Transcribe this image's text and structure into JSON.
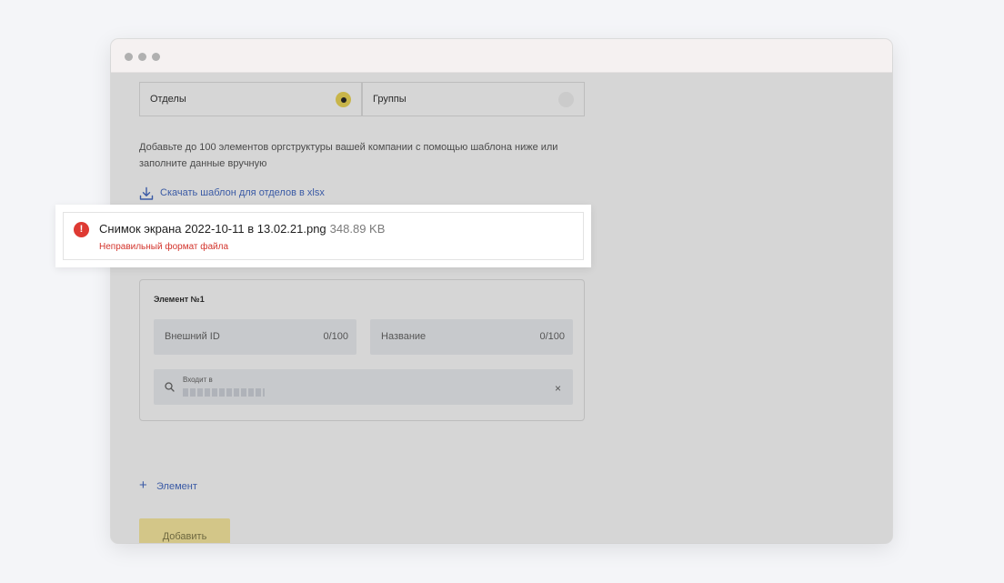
{
  "tabs": [
    {
      "label": "Отделы",
      "selected": true
    },
    {
      "label": "Группы",
      "selected": false
    }
  ],
  "description": "Добавьте до 100 элементов оргструктуры вашей компании с помощью шаблона ниже или заполните данные вручную",
  "download_link": "Скачать шаблон для отделов в xlsx",
  "error_toast": {
    "file_name": "Снимок экрана 2022-10-11 в 13.02.21.png",
    "file_size": "348.89 KB",
    "message": "Неправильный формат файла",
    "icon": "!"
  },
  "element_card": {
    "title": "Элемент №1",
    "external_id": {
      "label": "Внешний ID",
      "count": "0/100"
    },
    "name": {
      "label": "Название",
      "count": "0/100"
    },
    "parent": {
      "label": "Входит в"
    },
    "clear_icon": "×"
  },
  "add_element": {
    "icon": "+",
    "label": "Элемент"
  },
  "submit_button": "Добавить",
  "colors": {
    "link": "#3a5aa5",
    "error": "#de3a33",
    "accent": "#c8b54a",
    "overlay": "#d6d6d6"
  }
}
